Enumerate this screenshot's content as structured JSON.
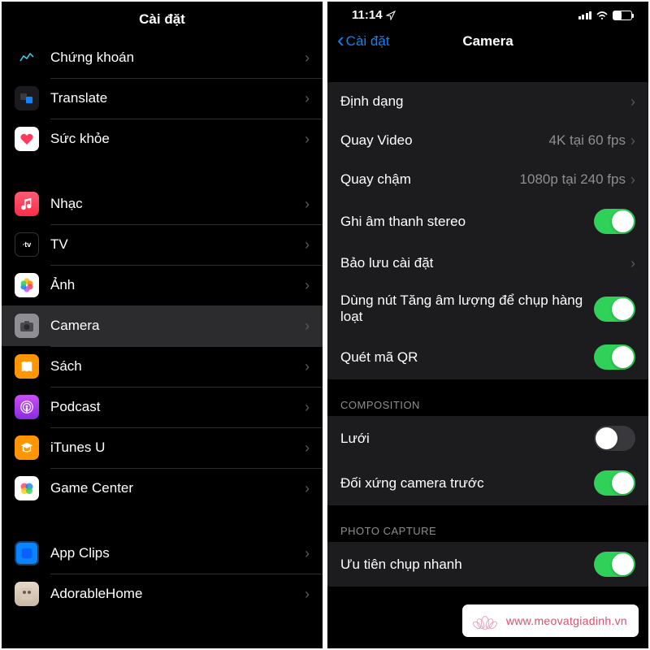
{
  "left": {
    "title": "Cài đặt",
    "items": [
      {
        "label": "Chứng khoán",
        "icon": "stocks"
      },
      {
        "label": "Translate",
        "icon": "translate"
      },
      {
        "label": "Sức khỏe",
        "icon": "health"
      }
    ],
    "items2": [
      {
        "label": "Nhạc",
        "icon": "music"
      },
      {
        "label": "TV",
        "icon": "tv"
      },
      {
        "label": "Ảnh",
        "icon": "photos"
      },
      {
        "label": "Camera",
        "icon": "camera",
        "selected": true
      },
      {
        "label": "Sách",
        "icon": "books"
      },
      {
        "label": "Podcast",
        "icon": "podcast"
      },
      {
        "label": "iTunes U",
        "icon": "itunesu"
      },
      {
        "label": "Game Center",
        "icon": "gamecenter"
      }
    ],
    "items3": [
      {
        "label": "App Clips",
        "icon": "appclips"
      },
      {
        "label": "AdorableHome",
        "icon": "adorable"
      }
    ]
  },
  "right": {
    "time": "11:14",
    "back": "Cài đặt",
    "title": "Camera",
    "rows": [
      {
        "label": "Định dạng",
        "type": "nav"
      },
      {
        "label": "Quay Video",
        "value": "4K tại 60 fps",
        "type": "nav"
      },
      {
        "label": "Quay chậm",
        "value": "1080p tại 240 fps",
        "type": "nav"
      },
      {
        "label": "Ghi âm thanh stereo",
        "type": "toggle",
        "on": true
      },
      {
        "label": "Bảo lưu cài đặt",
        "type": "nav"
      },
      {
        "label": "Dùng nút Tăng âm lượng để chụp hàng loạt",
        "type": "toggle",
        "on": true
      },
      {
        "label": "Quét mã QR",
        "type": "toggle",
        "on": true
      }
    ],
    "section2": "COMPOSITION",
    "rows2": [
      {
        "label": "Lưới",
        "type": "toggle",
        "on": false
      },
      {
        "label": "Đối xứng camera trước",
        "type": "toggle",
        "on": true
      }
    ],
    "section3": "PHOTO CAPTURE",
    "rows3": [
      {
        "label": "Ưu tiên chụp nhanh",
        "type": "toggle",
        "on": true
      }
    ]
  },
  "watermark": "www.meovatgiadinh.vn"
}
